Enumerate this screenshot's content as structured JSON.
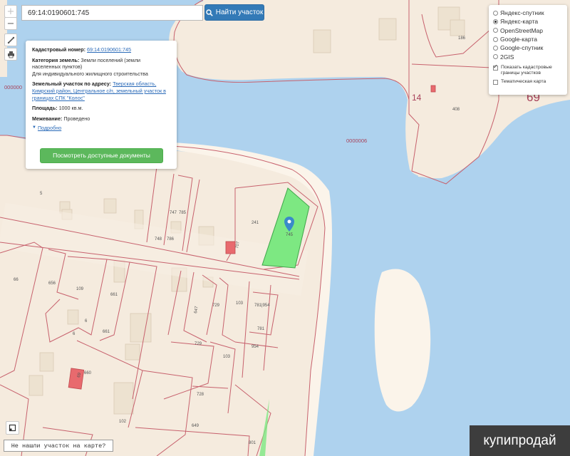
{
  "search": {
    "value": "69:14:0190601:745",
    "button_label": "Найти участок"
  },
  "controls": {
    "zoom_in": "+",
    "zoom_out": "−"
  },
  "info": {
    "cadastral_label": "Кадастровый номер:",
    "cadastral_number": "69:14:0190601:745",
    "category_label": "Категория земель:",
    "category_value": "Земли поселений (земли населенных пунктов)",
    "usage_value": "Для индивидуального жилищного строительства",
    "address_label": "Земельный участок по адресу:",
    "address_value": "Тверская область, Кимрский район, Центральное с/п, земельный участок в границах СПК \"Колос\"",
    "area_label": "Площадь:",
    "area_value": "1000 кв.м.",
    "survey_label": "Межевание:",
    "survey_value": "Проведено",
    "more_label": "Подробно",
    "docs_button": "Посмотреть доступные документы"
  },
  "layers": {
    "options": [
      "Яндекс-спутник",
      "Яндекс-карта",
      "OpenStreetMap",
      "Google-карта",
      "Google-спутник",
      "2GIS"
    ],
    "selected_index": 1,
    "show_boundaries_label": "Показать кадастровые границы участков",
    "show_boundaries_checked": true,
    "thematic_label": "Тематическая карта",
    "thematic_checked": false
  },
  "map_labels": {
    "block_69": "69",
    "block_14": "14",
    "block_0000006": "0000006",
    "block_000000": "000000",
    "p186": "186",
    "p408": "408",
    "p5": "5",
    "p747": "747",
    "p785": "785",
    "p748": "748",
    "p786": "786",
    "p241": "241",
    "p707": "707",
    "p745": "745",
    "p66": "66",
    "p656": "656",
    "p109": "109",
    "p661a": "661",
    "p661b": "661",
    "p6a": "6",
    "p6b": "6",
    "p647": "647",
    "p729a": "729",
    "p103a": "103",
    "p781": "781",
    "p954a": "954",
    "p781b": "781",
    "p954b": "954",
    "p729b": "729",
    "p103b": "103",
    "p660": "660",
    "p728": "728",
    "p102": "102",
    "p649": "649",
    "p801": "801",
    "p69small": "69"
  },
  "not_found_label": "Не нашли участок на карте?",
  "watermark": "купипродай",
  "colors": {
    "land": "#f5ebde",
    "water": "#aed2ee",
    "parcel_border": "#c7616d",
    "selected_parcel": "#7de882",
    "primary_button": "#337ab7",
    "success_button": "#5cb85c"
  }
}
